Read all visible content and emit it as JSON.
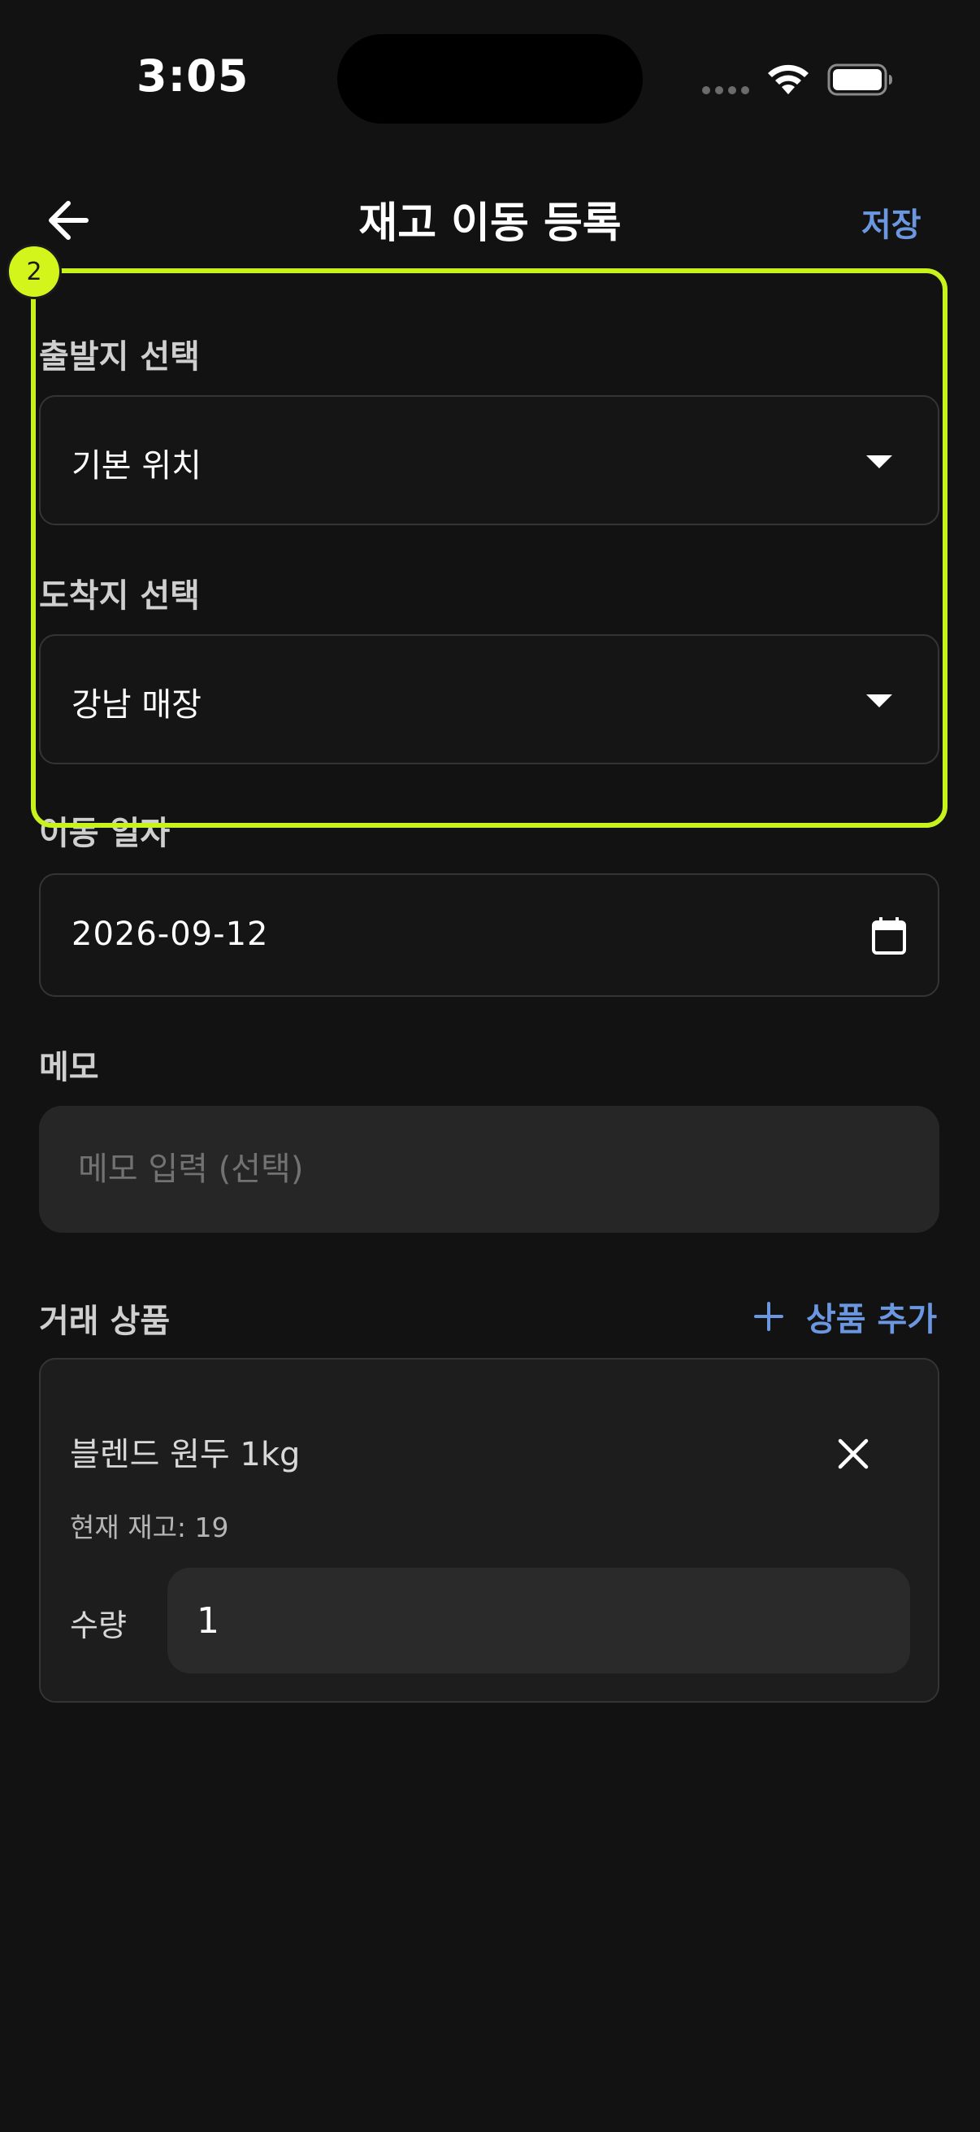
{
  "status_bar": {
    "time": "3:05"
  },
  "header": {
    "title": "재고 이동 등록",
    "save_label": "저장",
    "back_icon": "arrow-left-icon"
  },
  "form": {
    "origin": {
      "label": "출발지 선택",
      "value": "기본 위치"
    },
    "destination": {
      "label": "도착지 선택",
      "value": "강남 매장"
    },
    "date": {
      "label": "이동 일자",
      "value": "2026-09-12"
    },
    "memo": {
      "label": "메모",
      "value": "",
      "placeholder": "메모 입력 (선택)"
    }
  },
  "products": {
    "section_title": "거래 상품",
    "add_label": "상품 추가",
    "items": [
      {
        "name": "블렌드 원두 1kg",
        "stock_text": "현재 재고: 19",
        "quantity_label": "수량",
        "quantity": "1"
      }
    ]
  },
  "annotation": {
    "badge": "2",
    "color": "#c8f21c"
  },
  "colors": {
    "background": "#121212",
    "accent": "#6b96e0",
    "field_border": "#343434"
  }
}
